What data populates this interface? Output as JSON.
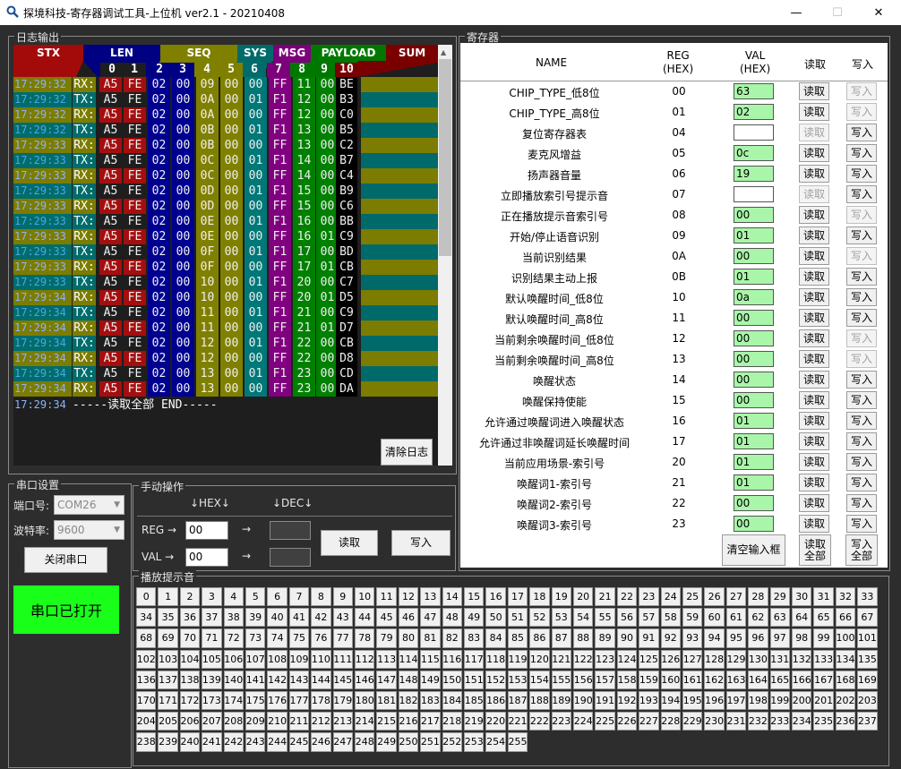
{
  "window": {
    "title": "探境科技-寄存器调试工具-上位机 ver2.1 - 20210408",
    "minimize": "—",
    "maximize": "☐",
    "close": "✕"
  },
  "log": {
    "group_title": "日志输出",
    "headers": [
      "STX",
      "LEN",
      "SEQ",
      "SYS",
      "MSG",
      "PAYLOAD",
      "SUM"
    ],
    "col_numbers": [
      "0",
      "1",
      "2",
      "3",
      "4",
      "5",
      "6",
      "7",
      "8",
      "9",
      "10"
    ],
    "rows": [
      {
        "time": "17:29:32",
        "dir": "RX:",
        "bytes": [
          "A5",
          "FE",
          "02",
          "00",
          "09",
          "00",
          "00",
          "FF",
          "11",
          "00",
          "BE"
        ]
      },
      {
        "time": "17:29:32",
        "dir": "TX:",
        "bytes": [
          "A5",
          "FE",
          "02",
          "00",
          "0A",
          "00",
          "01",
          "F1",
          "12",
          "00",
          "B3"
        ]
      },
      {
        "time": "17:29:32",
        "dir": "RX:",
        "bytes": [
          "A5",
          "FE",
          "02",
          "00",
          "0A",
          "00",
          "00",
          "FF",
          "12",
          "00",
          "C0"
        ]
      },
      {
        "time": "17:29:32",
        "dir": "TX:",
        "bytes": [
          "A5",
          "FE",
          "02",
          "00",
          "0B",
          "00",
          "01",
          "F1",
          "13",
          "00",
          "B5"
        ]
      },
      {
        "time": "17:29:33",
        "dir": "RX:",
        "bytes": [
          "A5",
          "FE",
          "02",
          "00",
          "0B",
          "00",
          "00",
          "FF",
          "13",
          "00",
          "C2"
        ]
      },
      {
        "time": "17:29:33",
        "dir": "TX:",
        "bytes": [
          "A5",
          "FE",
          "02",
          "00",
          "0C",
          "00",
          "01",
          "F1",
          "14",
          "00",
          "B7"
        ]
      },
      {
        "time": "17:29:33",
        "dir": "RX:",
        "bytes": [
          "A5",
          "FE",
          "02",
          "00",
          "0C",
          "00",
          "00",
          "FF",
          "14",
          "00",
          "C4"
        ]
      },
      {
        "time": "17:29:33",
        "dir": "TX:",
        "bytes": [
          "A5",
          "FE",
          "02",
          "00",
          "0D",
          "00",
          "01",
          "F1",
          "15",
          "00",
          "B9"
        ]
      },
      {
        "time": "17:29:33",
        "dir": "RX:",
        "bytes": [
          "A5",
          "FE",
          "02",
          "00",
          "0D",
          "00",
          "00",
          "FF",
          "15",
          "00",
          "C6"
        ]
      },
      {
        "time": "17:29:33",
        "dir": "TX:",
        "bytes": [
          "A5",
          "FE",
          "02",
          "00",
          "0E",
          "00",
          "01",
          "F1",
          "16",
          "00",
          "BB"
        ]
      },
      {
        "time": "17:29:33",
        "dir": "RX:",
        "bytes": [
          "A5",
          "FE",
          "02",
          "00",
          "0E",
          "00",
          "00",
          "FF",
          "16",
          "01",
          "C9"
        ]
      },
      {
        "time": "17:29:33",
        "dir": "TX:",
        "bytes": [
          "A5",
          "FE",
          "02",
          "00",
          "0F",
          "00",
          "01",
          "F1",
          "17",
          "00",
          "BD"
        ]
      },
      {
        "time": "17:29:33",
        "dir": "RX:",
        "bytes": [
          "A5",
          "FE",
          "02",
          "00",
          "0F",
          "00",
          "00",
          "FF",
          "17",
          "01",
          "CB"
        ]
      },
      {
        "time": "17:29:33",
        "dir": "TX:",
        "bytes": [
          "A5",
          "FE",
          "02",
          "00",
          "10",
          "00",
          "01",
          "F1",
          "20",
          "00",
          "C7"
        ]
      },
      {
        "time": "17:29:34",
        "dir": "RX:",
        "bytes": [
          "A5",
          "FE",
          "02",
          "00",
          "10",
          "00",
          "00",
          "FF",
          "20",
          "01",
          "D5"
        ]
      },
      {
        "time": "17:29:34",
        "dir": "TX:",
        "bytes": [
          "A5",
          "FE",
          "02",
          "00",
          "11",
          "00",
          "01",
          "F1",
          "21",
          "00",
          "C9"
        ]
      },
      {
        "time": "17:29:34",
        "dir": "RX:",
        "bytes": [
          "A5",
          "FE",
          "02",
          "00",
          "11",
          "00",
          "00",
          "FF",
          "21",
          "01",
          "D7"
        ]
      },
      {
        "time": "17:29:34",
        "dir": "TX:",
        "bytes": [
          "A5",
          "FE",
          "02",
          "00",
          "12",
          "00",
          "01",
          "F1",
          "22",
          "00",
          "CB"
        ]
      },
      {
        "time": "17:29:34",
        "dir": "RX:",
        "bytes": [
          "A5",
          "FE",
          "02",
          "00",
          "12",
          "00",
          "00",
          "FF",
          "22",
          "00",
          "D8"
        ]
      },
      {
        "time": "17:29:34",
        "dir": "TX:",
        "bytes": [
          "A5",
          "FE",
          "02",
          "00",
          "13",
          "00",
          "01",
          "F1",
          "23",
          "00",
          "CD"
        ]
      },
      {
        "time": "17:29:34",
        "dir": "RX:",
        "bytes": [
          "A5",
          "FE",
          "02",
          "00",
          "13",
          "00",
          "00",
          "FF",
          "23",
          "00",
          "DA"
        ]
      }
    ],
    "last_line_time": "17:29:34",
    "last_line_text": " -----读取全部 END-----",
    "clear_button": "清除日志",
    "colors": {
      "stx": "#a30b0b",
      "len": "#000082",
      "seq": "#7f7f00",
      "sys": "#006b6b",
      "msg": "#7c007c",
      "payload": "#007800",
      "sum": "#7a0000",
      "time_tx": "#4aa7e6"
    }
  },
  "serial": {
    "group_title": "串口设置",
    "port_label": "端口号:",
    "port_value": "COM26",
    "baud_label": "波特率:",
    "baud_value": "9600",
    "close_button": "关闭串口",
    "status": "串口已打开",
    "status_color": "#1aff1a"
  },
  "manual": {
    "group_title": "手动操作",
    "hex_header": "↓HEX↓",
    "dec_header": "↓DEC↓",
    "reg_label": "REG →",
    "val_label": "VAL →",
    "reg_value": "00",
    "val_value": "00",
    "arrow": "→",
    "read_button": "读取",
    "write_button": "写入"
  },
  "registers": {
    "group_title": "寄存器",
    "col_name": "NAME",
    "col_reg": "REG\n(HEX)",
    "col_val": "VAL\n(HEX)",
    "col_read": "读取",
    "col_write": "写入",
    "read_label": "读取",
    "write_label": "写入",
    "rows": [
      {
        "name": "CHIP_TYPE_低8位",
        "reg": "00",
        "val": "63",
        "white": false,
        "read_enabled": true,
        "write_enabled": false
      },
      {
        "name": "CHIP_TYPE_高8位",
        "reg": "01",
        "val": "02",
        "white": false,
        "read_enabled": true,
        "write_enabled": false
      },
      {
        "name": "复位寄存器表",
        "reg": "04",
        "val": "",
        "white": true,
        "read_enabled": false,
        "write_enabled": true
      },
      {
        "name": "麦克风增益",
        "reg": "05",
        "val": "0c",
        "white": false,
        "read_enabled": true,
        "write_enabled": true
      },
      {
        "name": "扬声器音量",
        "reg": "06",
        "val": "19",
        "white": false,
        "read_enabled": true,
        "write_enabled": true
      },
      {
        "name": "立即播放索引号提示音",
        "reg": "07",
        "val": "",
        "white": true,
        "read_enabled": false,
        "write_enabled": true
      },
      {
        "name": "正在播放提示音索引号",
        "reg": "08",
        "val": "00",
        "white": false,
        "read_enabled": true,
        "write_enabled": false
      },
      {
        "name": "开始/停止语音识别",
        "reg": "09",
        "val": "01",
        "white": false,
        "read_enabled": true,
        "write_enabled": true
      },
      {
        "name": "当前识别结果",
        "reg": "0A",
        "val": "00",
        "white": false,
        "read_enabled": true,
        "write_enabled": false
      },
      {
        "name": "识别结果主动上报",
        "reg": "0B",
        "val": "01",
        "white": false,
        "read_enabled": true,
        "write_enabled": true
      },
      {
        "name": "默认唤醒时间_低8位",
        "reg": "10",
        "val": "0a",
        "white": false,
        "read_enabled": true,
        "write_enabled": true
      },
      {
        "name": "默认唤醒时间_高8位",
        "reg": "11",
        "val": "00",
        "white": false,
        "read_enabled": true,
        "write_enabled": true
      },
      {
        "name": "当前剩余唤醒时间_低8位",
        "reg": "12",
        "val": "00",
        "white": false,
        "read_enabled": true,
        "write_enabled": false
      },
      {
        "name": "当前剩余唤醒时间_高8位",
        "reg": "13",
        "val": "00",
        "white": false,
        "read_enabled": true,
        "write_enabled": false
      },
      {
        "name": "唤醒状态",
        "reg": "14",
        "val": "00",
        "white": false,
        "read_enabled": true,
        "write_enabled": true
      },
      {
        "name": "唤醒保持使能",
        "reg": "15",
        "val": "00",
        "white": false,
        "read_enabled": true,
        "write_enabled": true
      },
      {
        "name": "允许通过唤醒词进入唤醒状态",
        "reg": "16",
        "val": "01",
        "white": false,
        "read_enabled": true,
        "write_enabled": true
      },
      {
        "name": "允许通过非唤醒词延长唤醒时间",
        "reg": "17",
        "val": "01",
        "white": false,
        "read_enabled": true,
        "write_enabled": true
      },
      {
        "name": "当前应用场景-索引号",
        "reg": "20",
        "val": "01",
        "white": false,
        "read_enabled": true,
        "write_enabled": true
      },
      {
        "name": "唤醒词1-索引号",
        "reg": "21",
        "val": "01",
        "white": false,
        "read_enabled": true,
        "write_enabled": true
      },
      {
        "name": "唤醒词2-索引号",
        "reg": "22",
        "val": "00",
        "white": false,
        "read_enabled": true,
        "write_enabled": true
      },
      {
        "name": "唤醒词3-索引号",
        "reg": "23",
        "val": "00",
        "white": false,
        "read_enabled": true,
        "write_enabled": true
      }
    ],
    "clear_inputs": "清空输入框",
    "read_all": "读取\n全部",
    "write_all": "写入\n全部"
  },
  "sounds": {
    "group_title": "播放提示音",
    "count": 256
  }
}
